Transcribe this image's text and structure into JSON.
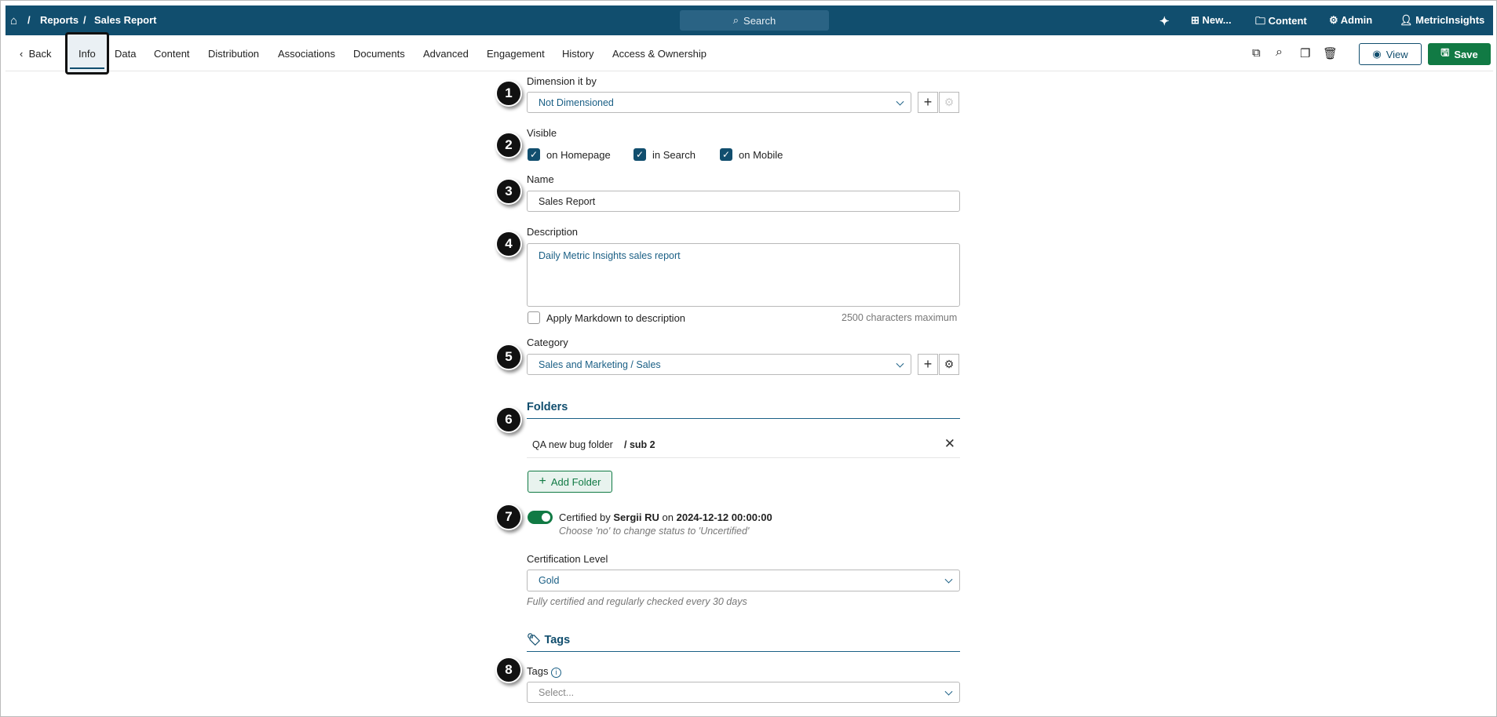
{
  "header": {
    "breadcrumb": [
      "Reports",
      "Sales Report"
    ],
    "search": "Search",
    "new": "New...",
    "content": "Content",
    "admin": "Admin",
    "user": "MetricInsights"
  },
  "tabs": {
    "back": "Back",
    "items": [
      "Info",
      "Data",
      "Content",
      "Distribution",
      "Associations",
      "Documents",
      "Advanced",
      "Engagement",
      "History",
      "Access & Ownership"
    ],
    "view": "View",
    "save": "Save"
  },
  "form": {
    "dimension_label": "Dimension it by",
    "dimension_value": "Not Dimensioned",
    "visible_label": "Visible",
    "visible": [
      "on Homepage",
      "in Search",
      "on Mobile"
    ],
    "name_label": "Name",
    "name_value": "Sales Report",
    "description_label": "Description",
    "description_value": "Daily Metric Insights sales report",
    "markdown_label": "Apply Markdown to description",
    "char_limit": "2500 characters maximum",
    "category_label": "Category",
    "category_value": "Sales and Marketing / Sales",
    "folders_heading": "Folders",
    "folder_name": "QA new bug folder",
    "folder_sub": "/ sub 2",
    "add_folder": "Add Folder",
    "cert_prefix": "Certified by",
    "cert_user": "Sergii RU",
    "cert_on": "on",
    "cert_date": "2024-12-12 00:00:00",
    "cert_hint": "Choose 'no' to change status to 'Uncertified'",
    "cert_level_label": "Certification Level",
    "cert_level_value": "Gold",
    "cert_level_help": "Fully certified and regularly checked every 30 days",
    "tags_heading": "Tags",
    "tags_label": "Tags",
    "tags_placeholder": "Select..."
  },
  "badges": [
    "1",
    "2",
    "3",
    "4",
    "5",
    "6",
    "7",
    "8"
  ],
  "colors": {
    "header": "#114e6e",
    "save": "#117a44",
    "accent": "#1a5f85"
  }
}
